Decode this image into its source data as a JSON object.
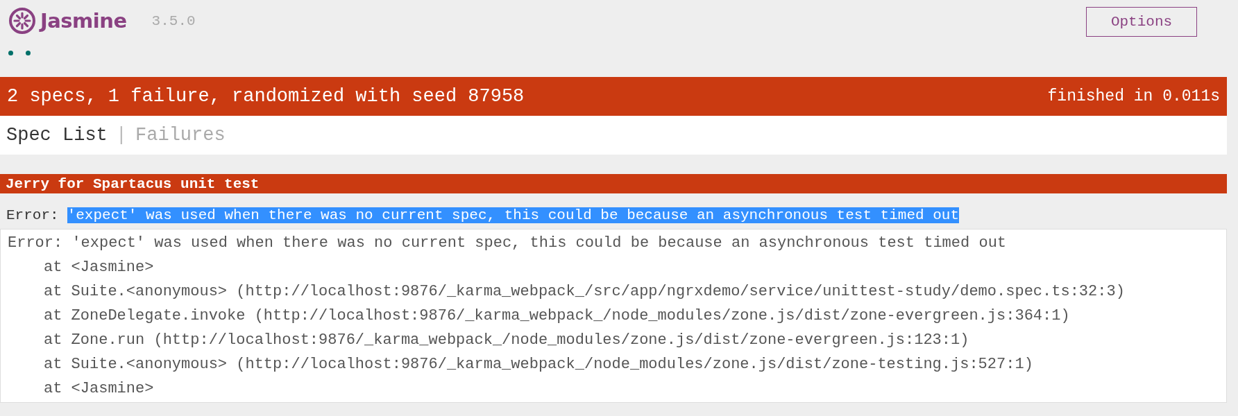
{
  "header": {
    "logo_text": "Jasmine",
    "version": "3.5.0",
    "options_button": "Options"
  },
  "spec_dots": [
    {
      "passed": true
    },
    {
      "passed": true
    }
  ],
  "summary": {
    "failed": true,
    "text": "2 specs, 1 failure, randomized with seed 87958",
    "duration": "finished in 0.011s"
  },
  "tabs": [
    {
      "label": "Spec List",
      "selected": true
    },
    {
      "label": "Failures",
      "selected": false
    }
  ],
  "tab_separator": "|",
  "suites": [
    {
      "title": "Jerry for Spartacus unit test",
      "failed": true,
      "failures": [
        {
          "label": "Error:",
          "message": "'expect' was used when there was no current spec, this could be because an asynchronous test timed out",
          "highlighted": true,
          "stack": {
            "message": "Error: 'expect' was used when there was no current spec, this could be because an asynchronous test timed out",
            "frames": [
              "at <Jasmine>",
              "at Suite.<anonymous> (http://localhost:9876/_karma_webpack_/src/app/ngrxdemo/service/unittest-study/demo.spec.ts:32:3)",
              "at ZoneDelegate.invoke (http://localhost:9876/_karma_webpack_/node_modules/zone.js/dist/zone-evergreen.js:364:1)",
              "at Zone.run (http://localhost:9876/_karma_webpack_/node_modules/zone.js/dist/zone-evergreen.js:123:1)",
              "at Suite.<anonymous> (http://localhost:9876/_karma_webpack_/node_modules/zone.js/dist/zone-testing.js:527:1)",
              "at <Jasmine>"
            ]
          }
        }
      ]
    }
  ]
}
